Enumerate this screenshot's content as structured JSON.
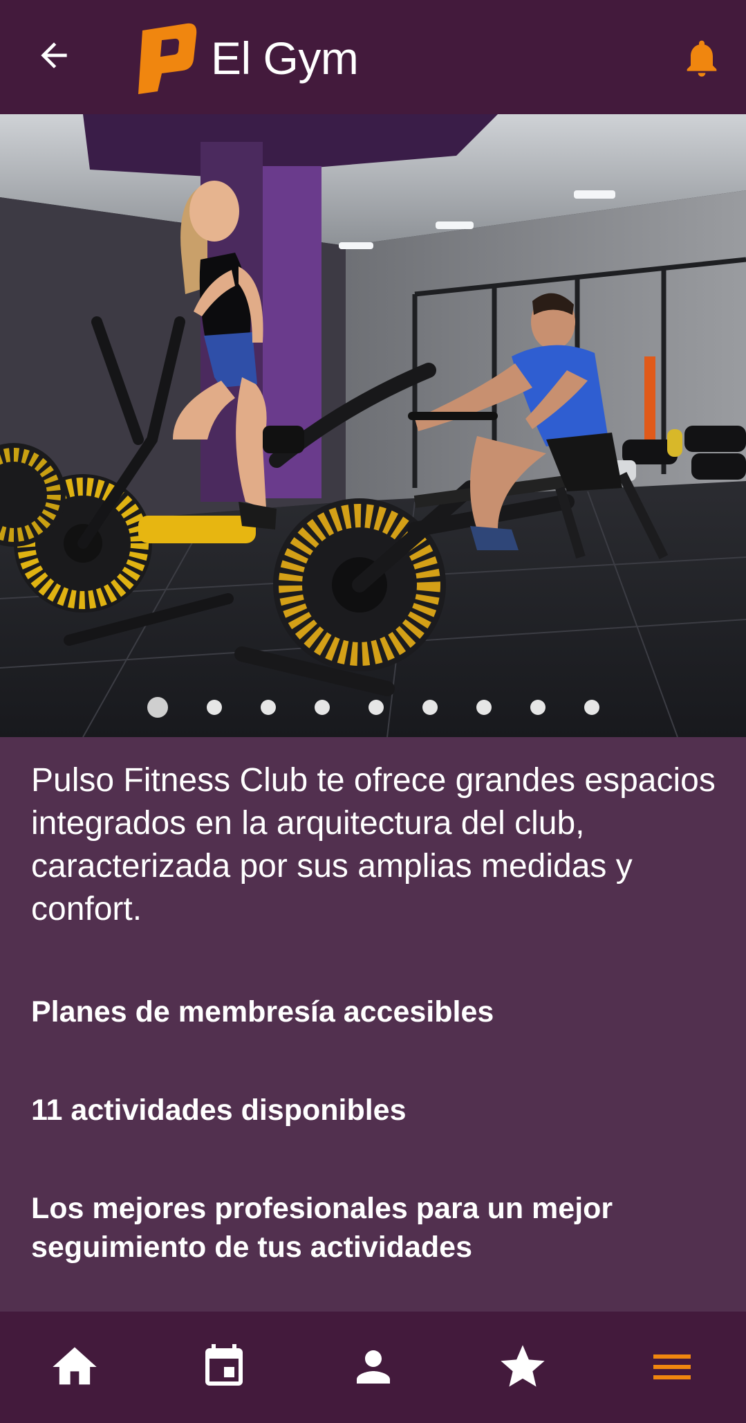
{
  "header": {
    "title": "El Gym",
    "back_icon": "arrow-left-icon",
    "logo_icon": "brand-p-logo",
    "notification_icon": "bell-icon",
    "accent_color": "#f0860f",
    "background_color": "#431a3c"
  },
  "carousel": {
    "slide_count": 9,
    "active_index": 0
  },
  "main": {
    "intro": "Pulso Fitness Club te ofrece grandes espacios integrados en la arquitectura del club, caracterizada por sus amplias medidas y confort.",
    "features": [
      "Planes de membresía accesibles",
      "11 actividades disponibles",
      "Los mejores profesionales para un mejor seguimiento de tus actividades"
    ],
    "background_color": "#52304f"
  },
  "bottom_nav": {
    "items": [
      {
        "icon": "home-icon",
        "active": false
      },
      {
        "icon": "calendar-icon",
        "active": false
      },
      {
        "icon": "person-icon",
        "active": false
      },
      {
        "icon": "star-icon",
        "active": false
      },
      {
        "icon": "menu-icon",
        "active": true
      }
    ],
    "active_color": "#f0860f",
    "inactive_color": "#ffffff"
  }
}
